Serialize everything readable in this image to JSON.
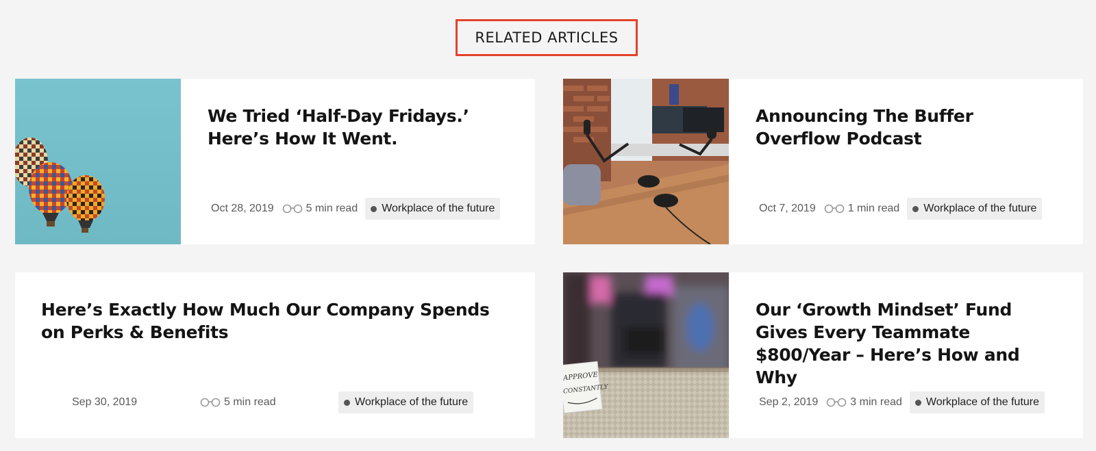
{
  "section": {
    "title": "RELATED ARTICLES"
  },
  "articles": [
    {
      "title": "We Tried ‘Half-Day Fridays.’ Here’s How It Went.",
      "date": "Oct 28, 2019",
      "read_time": "5 min read",
      "tag": "Workplace of the future",
      "image": "hot-air-balloons"
    },
    {
      "title": "Announcing The Buffer Overflow Podcast",
      "date": "Oct 7, 2019",
      "read_time": "1 min read",
      "tag": "Workplace of the future",
      "image": "podcast-studio"
    },
    {
      "title": "Here’s Exactly How Much Our Company Spends on Perks & Benefits",
      "date": "Sep 30, 2019",
      "read_time": "5 min read",
      "tag": "Workplace of the future",
      "image": ""
    },
    {
      "title": "Our ‘Growth Mindset’ Fund Gives Every Teammate $800/Year – Here’s How and Why",
      "date": "Sep 2, 2019",
      "read_time": "3 min read",
      "tag": "Workplace of the future",
      "image": "blurred-gym-with-note"
    }
  ],
  "images": {
    "note_text": "APPROVE CONSTANTLY"
  },
  "colors": {
    "accent": "#e2432a",
    "background": "#f4f4f4",
    "card": "#ffffff",
    "tag_bg": "#eeeeee"
  }
}
